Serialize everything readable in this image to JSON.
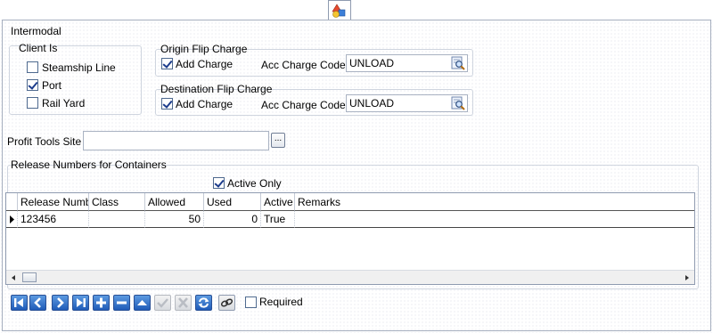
{
  "section": {
    "title": "Intermodal"
  },
  "client": {
    "legend": "Client Is",
    "options": [
      {
        "label": "Steamship Line",
        "checked": false
      },
      {
        "label": "Port",
        "checked": true
      },
      {
        "label": "Rail Yard",
        "checked": false
      }
    ]
  },
  "origin_flip": {
    "legend": "Origin Flip Charge",
    "add_charge_label": "Add Charge",
    "add_charge_checked": true,
    "code_label": "Acc Charge Code",
    "code_value": "UNLOAD"
  },
  "destination_flip": {
    "legend": "Destination Flip Charge",
    "add_charge_label": "Add Charge",
    "add_charge_checked": true,
    "code_label": "Acc Charge Code",
    "code_value": "UNLOAD"
  },
  "profit_tools": {
    "label": "Profit Tools Site",
    "value": "",
    "browse_label": "..."
  },
  "release": {
    "legend": "Release Numbers for Containers",
    "active_only_label": "Active Only",
    "active_only_checked": true,
    "columns": [
      "Release Numb",
      "Class",
      "Allowed",
      "Used",
      "Active",
      "Remarks"
    ],
    "rows": [
      {
        "release": "123456",
        "class": "",
        "allowed": "50",
        "used": "0",
        "active": "True",
        "remarks": ""
      }
    ]
  },
  "toolbar": {
    "buttons": [
      "first-icon",
      "prev-icon",
      "next-icon",
      "last-icon",
      "add-icon",
      "remove-icon",
      "up-icon",
      "confirm-icon",
      "cancel-icon",
      "refresh-icon",
      "link-icon"
    ],
    "required_label": "Required",
    "required_checked": false
  },
  "colors": {
    "accent": "#1f5bb8",
    "border": "#8f9bb0"
  }
}
